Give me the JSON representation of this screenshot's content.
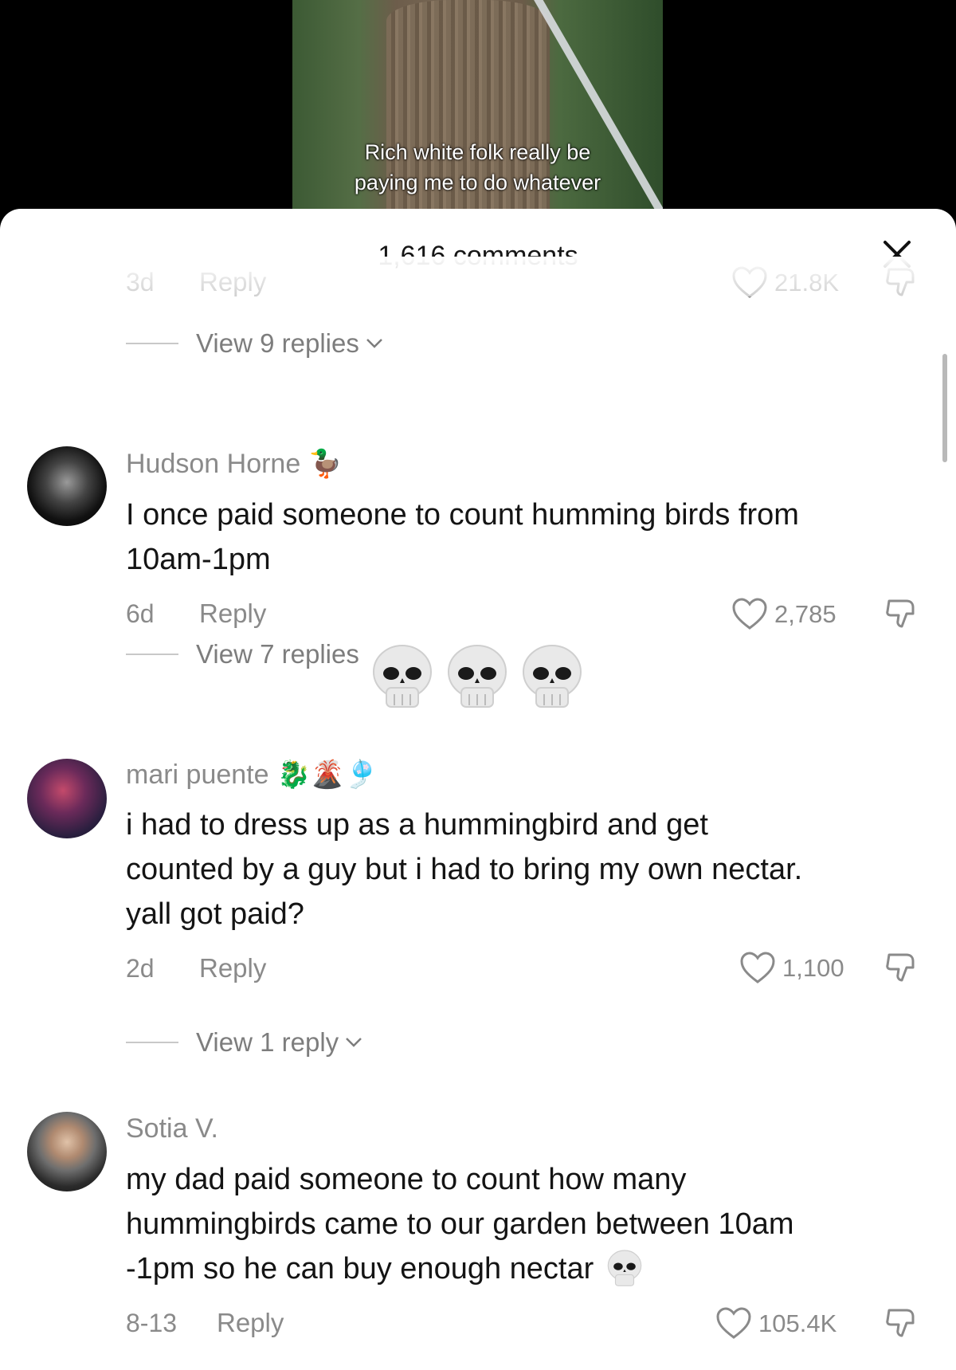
{
  "video": {
    "caption_line1": "Rich white folk really be",
    "caption_line2": "paying me to do whatever"
  },
  "header": {
    "title": "1,616 comments",
    "close_icon": "close-icon"
  },
  "top_partial": {
    "age": "3d",
    "reply": "Reply",
    "likes": "21.8K",
    "view_replies": "View 9 replies"
  },
  "comments": [
    {
      "author": "Hudson Horne",
      "author_emoji": "🦆",
      "text_line1": "I once paid someone to count humming birds from",
      "text_line2": "10am-1pm",
      "age": "6d",
      "reply": "Reply",
      "likes": "2,785",
      "view_replies": "View 7 replies"
    },
    {
      "author": "mari puente",
      "author_emoji": "🐉🌋🎐",
      "text_line1": "i had to dress up as a hummingbird and get",
      "text_line2": "counted by a guy but i had to bring my own nectar.",
      "text_line3": "yall got paid?",
      "age": "2d",
      "reply": "Reply",
      "likes": "1,100",
      "view_replies": "View 1 reply"
    },
    {
      "author": "Sotia V.",
      "text_line1": "my dad paid someone to count how many",
      "text_line2": "hummingbirds came to our garden between 10am",
      "text_line3": "-1pm so he can buy enough nectar",
      "age": "8-13",
      "reply": "Reply",
      "likes": "105.4K"
    }
  ],
  "colors": {
    "sheet_bg": "#ffffff",
    "text_primary": "#141414",
    "text_secondary": "#8a8a8a"
  }
}
